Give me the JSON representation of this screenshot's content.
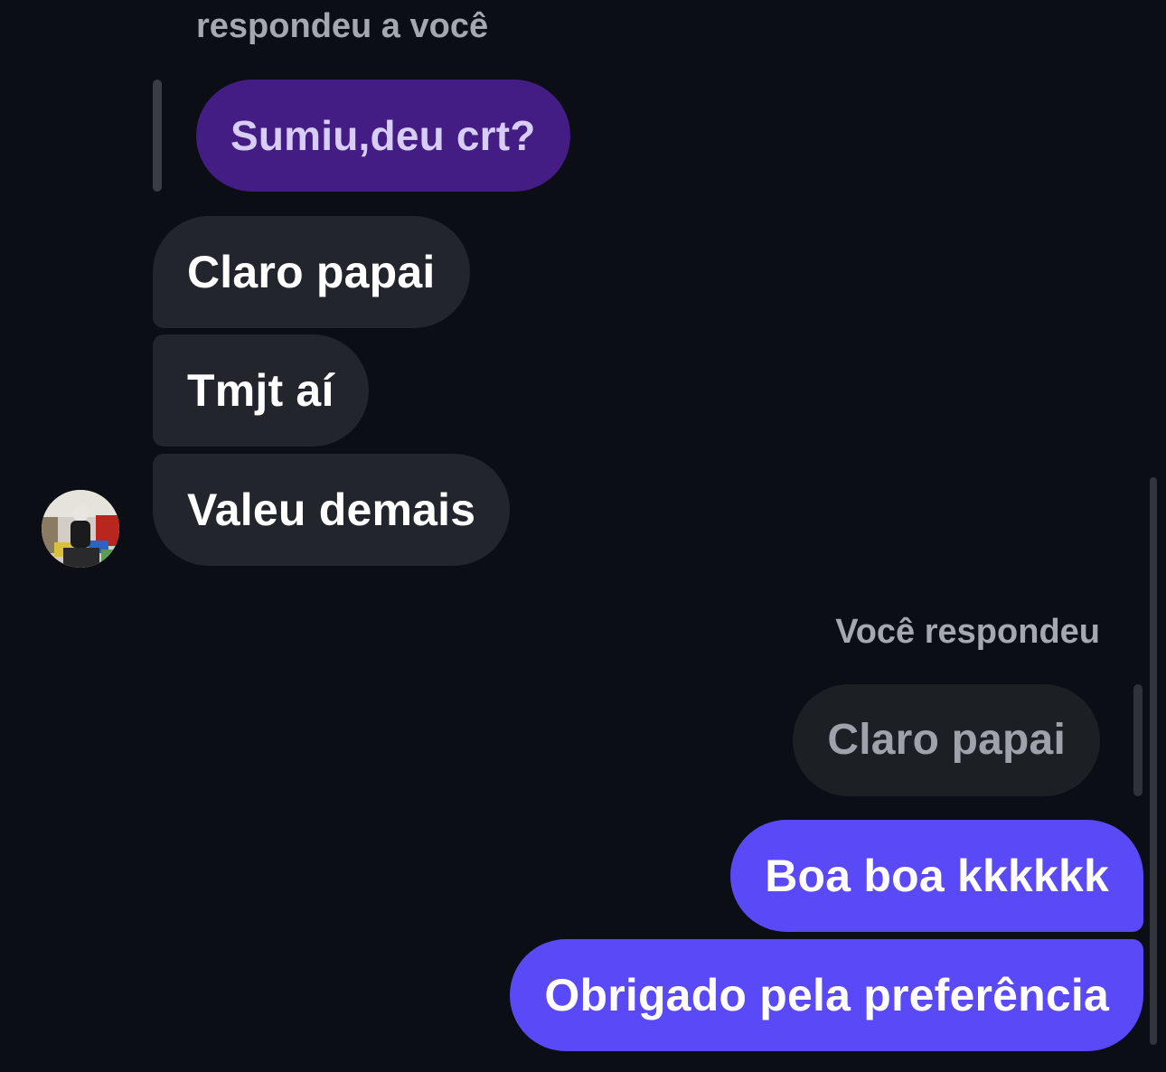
{
  "thread": {
    "reply_caption_theirs": "respondeu a você",
    "quoted_theirs": "Sumiu,deu crt?",
    "incoming": [
      {
        "text": "Claro papai"
      },
      {
        "text": "Tmjt aí"
      },
      {
        "text": "Valeu demais"
      }
    ],
    "reply_caption_mine": "Você respondeu",
    "quoted_mine": "Claro papai",
    "outgoing": [
      {
        "text": "Boa boa kkkkkk"
      },
      {
        "text": "Obrigado pela preferência"
      }
    ]
  },
  "colors": {
    "background": "#0b0e14",
    "incoming_bubble": "#22252b",
    "outgoing_bubble": "#5a49f7",
    "quoted_bubble_theirs": "#431c84",
    "caption": "#a3a8b1"
  },
  "icons": {
    "avatar": "profile-photo"
  }
}
